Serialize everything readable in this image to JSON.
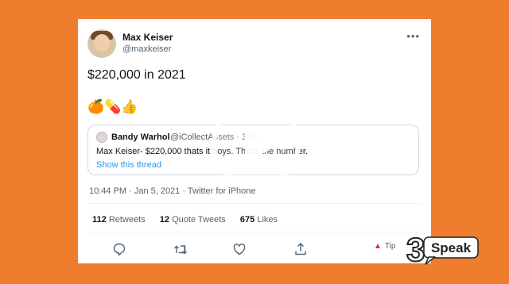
{
  "tweet": {
    "author_name": "Max Keiser",
    "author_handle": "@maxkeiser",
    "more_label": "•••",
    "text": "$220,000 in 2021",
    "emojis": "🍊💊👍",
    "timestamp": "10:44 PM · Jan 5, 2021 · Twitter for iPhone"
  },
  "quote": {
    "author_name": "Bandy Warhol",
    "author_handle_time": "@iCollectAssets · 36m",
    "text": "Max Keiser- $220,000 thats it boys.  That's the number.",
    "show_thread": "Show this thread"
  },
  "stats": {
    "retweets_count": "112",
    "retweets_label": "Retweets",
    "quote_count": "12",
    "quote_label": "Quote Tweets",
    "likes_count": "675",
    "likes_label": "Likes"
  },
  "actions": {
    "tip_label": "Tip"
  },
  "brand": {
    "logo_text": "Speak",
    "logo_number": "3"
  },
  "colors": {
    "background": "#ef7d2e",
    "link": "#1d9bf0",
    "tip": "#e0245e"
  }
}
